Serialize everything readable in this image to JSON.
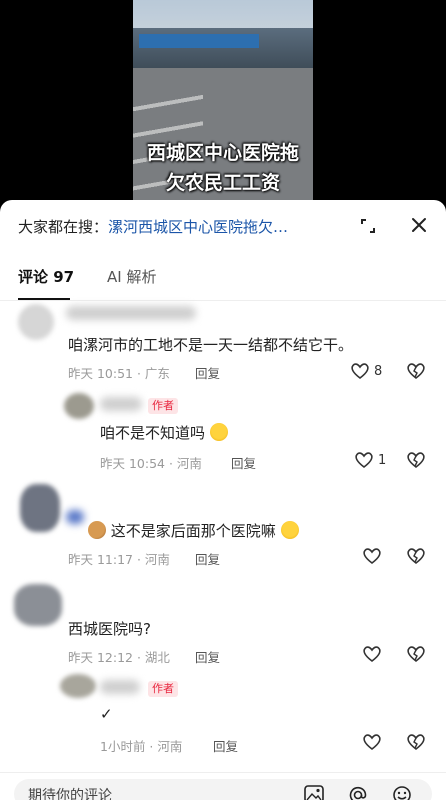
{
  "video": {
    "caption_line1": "西城区中心医院拖",
    "caption_line2": "欠农民工工资"
  },
  "header": {
    "search_prefix": "大家都在搜：",
    "search_link": "漯河西城区中心医院拖欠…",
    "expand_icon": "expand-icon",
    "close_icon": "close-icon"
  },
  "tabs": [
    {
      "label": "评论 97"
    },
    {
      "label": "AI 解析"
    }
  ],
  "comments": [
    {
      "text": "咱漯河市的工地不是一天一结都不结它干。",
      "time": "昨天 10:51 · 广东",
      "reply": "回复",
      "likes": "8"
    },
    {
      "text": "咱不是不知道吗",
      "time": "昨天 10:54 · 河南",
      "reply": "回复",
      "likes": "1",
      "badge": "作者"
    },
    {
      "text": "这不是家后面那个医院嘛",
      "time": "昨天 11:17 · 河南",
      "reply": "回复",
      "likes": ""
    },
    {
      "text": "西城医院吗?",
      "time": "昨天 12:12 · 湖北",
      "reply": "回复",
      "likes": ""
    },
    {
      "text": "✓",
      "time": "1小时前 · 河南",
      "reply": "回复",
      "likes": "",
      "badge": "作者"
    }
  ],
  "input": {
    "placeholder": "期待你的评论",
    "icons": [
      "image-icon",
      "at-icon",
      "emoji-icon"
    ]
  },
  "colors": {
    "link": "#1b55a8",
    "author_badge": "#e8273f"
  }
}
